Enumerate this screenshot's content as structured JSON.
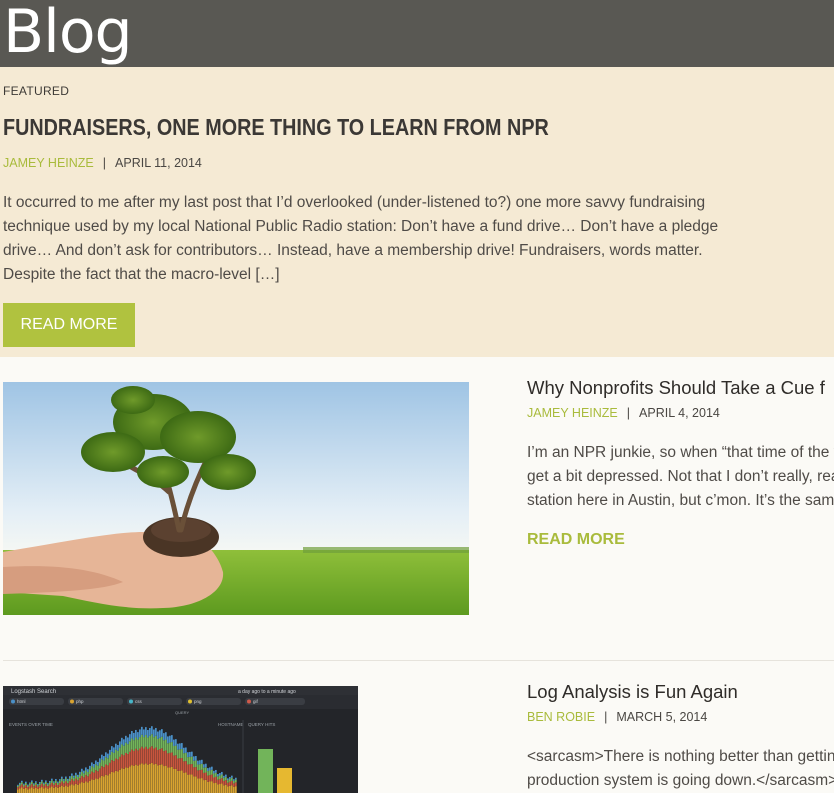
{
  "header": {
    "title": "Blog"
  },
  "featured": {
    "label": "FEATURED",
    "title": "FUNDRAISERS, ONE MORE THING TO LEARN FROM NPR",
    "author": "JAMEY HEINZE",
    "separator": "|",
    "date": "APRIL 11, 2014",
    "excerpt_lines": [
      "It occurred to me after my last post that I’d overlooked (under-listened to?) one more savvy fundraising",
      "technique used by my local National Public Radio station:  Don’t have a fund drive…  Don’t have a pledge",
      "drive…  And don’t ask for contributors… Instead, have a membership drive!  Fundraisers, words matter.",
      "Despite the fact that the macro-level […]"
    ],
    "read_more": "READ MORE"
  },
  "posts": [
    {
      "title": "Why Nonprofits Should Take a Cue f",
      "author": "JAMEY HEINZE",
      "separator": "|",
      "date": "APRIL 4, 2014",
      "excerpt_lines": [
        "I’m an NPR junkie, so when “that time of the y",
        "get a bit depressed.  Not that I don’t really, rea",
        "station here in Austin, but c’mon.  It’s the sam"
      ],
      "read_more": "READ MORE",
      "image": "hands-holding-tree-photo"
    },
    {
      "title": "Log Analysis is Fun Again",
      "author": "BEN ROBIE",
      "separator": "|",
      "date": "MARCH 5, 2014",
      "excerpt_lines": [
        "<sarcasm>There is nothing better than gettin",
        "production system is going down.</sarcasm>"
      ],
      "image": "logstash-dashboard-screenshot",
      "image_text": {
        "app_name": "Logstash Search",
        "time_filter": "a day ago to a minute ago",
        "panel_events": "EVENTS OVER TIME",
        "panel_hosts": "HOSTNAME",
        "panel_query": "QUERY HITS",
        "query_label": "QUERY",
        "search_tags": [
          "html",
          "php",
          "css",
          "png",
          "gif"
        ]
      }
    }
  ],
  "colors": {
    "header_bg": "#595853",
    "featured_bg": "#f5ead4",
    "accent_green": "#b0c23f",
    "page_bg": "#fbfaf6"
  }
}
